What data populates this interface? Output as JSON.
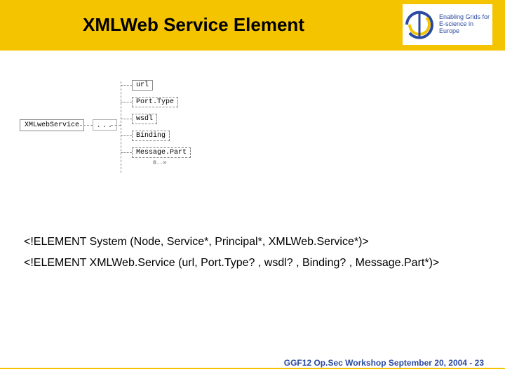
{
  "header": {
    "title": "XMLWeb Service Element",
    "logo": {
      "tagline_l1": "Enabling Grids for",
      "tagline_l2": "E-science in Europe"
    }
  },
  "diagram": {
    "root": "XMLwebService",
    "connector": "...",
    "children": {
      "c1": "url",
      "c2": "Port.Type",
      "c3": "wsdl",
      "c4": "Binding",
      "c5": "Message.Part"
    },
    "cardinality": "0..∞"
  },
  "dtd": {
    "line1": "<!ELEMENT System (Node, Service*, Principal*, XMLWeb.Service*)>",
    "line2": "<!ELEMENT XMLWeb.Service (url, Port.Type? , wsdl? , Binding? , Message.Part*)>"
  },
  "footer": {
    "text_prefix": "GGF12 Op.Sec Workshop September 20, 2004  - ",
    "page": "23"
  }
}
